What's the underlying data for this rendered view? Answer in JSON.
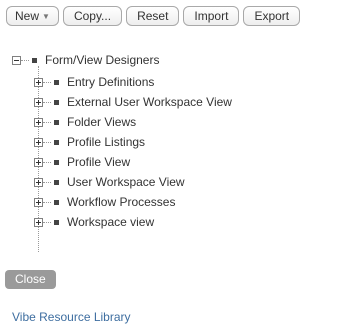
{
  "toolbar": {
    "new_label": "New",
    "copy_label": "Copy...",
    "reset_label": "Reset",
    "import_label": "Import",
    "export_label": "Export"
  },
  "tree": {
    "root_label": "Form/View Designers",
    "children": [
      {
        "label": "Entry Definitions"
      },
      {
        "label": "External User Workspace View"
      },
      {
        "label": "Folder Views"
      },
      {
        "label": "Profile Listings"
      },
      {
        "label": "Profile View"
      },
      {
        "label": "User Workspace View"
      },
      {
        "label": "Workflow Processes"
      },
      {
        "label": "Workspace view"
      }
    ]
  },
  "close_label": "Close",
  "library_link": "Vibe Resource Library",
  "icons": {
    "new_caret": "chevron-down-icon",
    "root_toggle": "collapse-minus-icon",
    "child_toggle": "expand-plus-icon",
    "node_bullet": "square-bullet-icon"
  },
  "colors": {
    "link": "#3e6ea0",
    "close_button_bg": "#9a9a9a",
    "text": "#333333"
  }
}
